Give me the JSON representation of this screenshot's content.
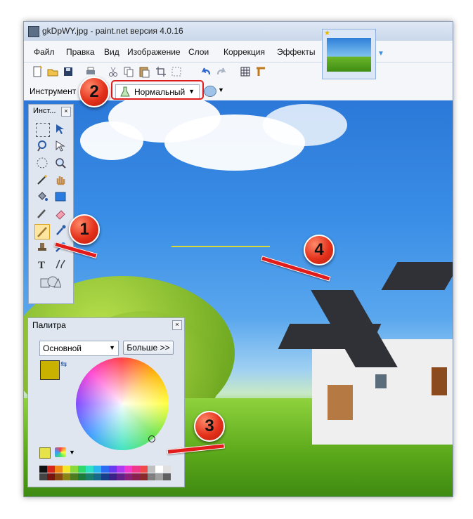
{
  "window": {
    "title": "gkDpWY.jpg - paint.net версия 4.0.16"
  },
  "menu": [
    "Файл",
    "Правка",
    "Вид",
    "Изображение",
    "Слои",
    "Коррекция",
    "Эффекты"
  ],
  "toolbar2": {
    "label": "Инструмент",
    "blend_mode": "Нормальный"
  },
  "tools_panel": {
    "title": "Инст..."
  },
  "palette_panel": {
    "title": "Палитра",
    "mode": "Основной",
    "more_button": "Больше >>"
  },
  "annotations": [
    "1",
    "2",
    "3",
    "4"
  ],
  "colors": {
    "primary": "#c9b200",
    "secondary": "#ffffff",
    "drawn_line": "#d9d93a",
    "annotation": "#e21b1b"
  },
  "icons": [
    "app-icon",
    "new-icon",
    "open-icon",
    "save-icon",
    "print-icon",
    "cut-icon",
    "copy-icon",
    "paste-icon",
    "crop-icon",
    "deselect-icon",
    "undo-icon",
    "redo-icon",
    "grid-icon",
    "ruler-icon",
    "flask-icon"
  ]
}
